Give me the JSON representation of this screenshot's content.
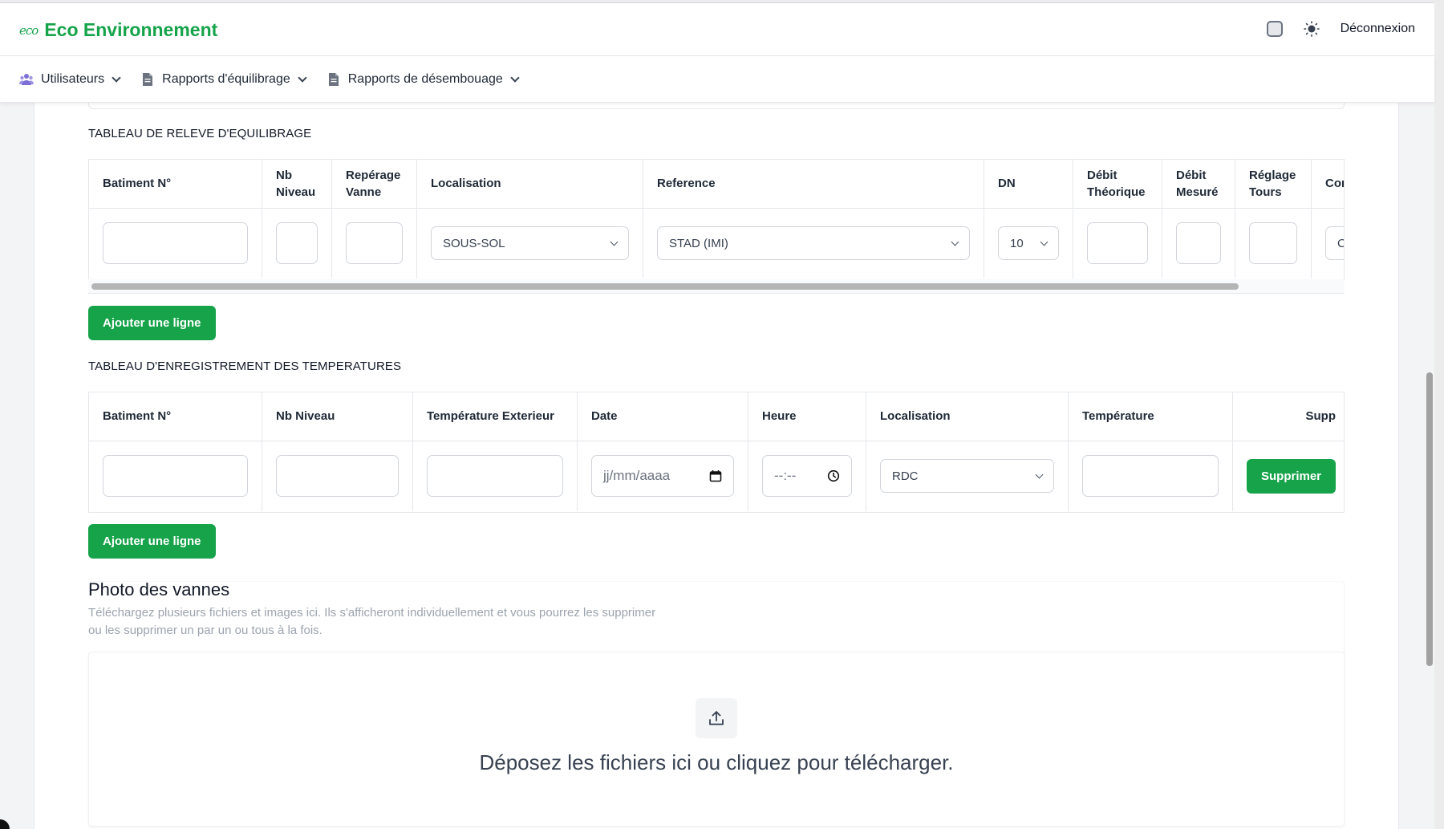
{
  "header": {
    "logo_text": "eco",
    "brand": "Eco Environnement",
    "logout": "Déconnexion"
  },
  "nav": {
    "items": [
      {
        "label": "Utilisateurs"
      },
      {
        "label": "Rapports d'équilibrage"
      },
      {
        "label": "Rapports de désembouage"
      }
    ]
  },
  "releve": {
    "title": "TABLEAU DE RELEVE D'EQUILIBRAGE",
    "headers": [
      "Batiment N°",
      "Nb Niveau",
      "Repérage Vanne",
      "Localisation",
      "Reference",
      "DN",
      "Débit Théorique",
      "Débit Mesuré",
      "Réglage Tours",
      "Conf"
    ],
    "localisation_value": "SOUS-SOL",
    "reference_value": "STAD (IMI)",
    "dn_value": "10",
    "conf_value": "C",
    "add_button": "Ajouter une ligne"
  },
  "temperatures": {
    "title": "TABLEAU D'ENREGISTREMENT DES TEMPERATURES",
    "headers": [
      "Batiment N°",
      "Nb Niveau",
      "Température Exterieur",
      "Date",
      "Heure",
      "Localisation",
      "Température",
      "Supp"
    ],
    "date_placeholder": "jj/mm/aaaa",
    "time_placeholder": "--:--",
    "localisation_value": "RDC",
    "delete_button": "Supprimer",
    "add_button": "Ajouter une ligne"
  },
  "photos": {
    "title": "Photo des vannes",
    "description": "Téléchargez plusieurs fichiers et images ici. Ils s'afficheront individuellement et vous pourrez les supprimer ou les supprimer un par un ou tous à la fois.",
    "drop_text": "Déposez les fichiers ici ou cliquez pour télécharger."
  },
  "colors": {
    "accent": "#16a34a",
    "text": "#1f2937",
    "border": "#e5e7eb"
  }
}
